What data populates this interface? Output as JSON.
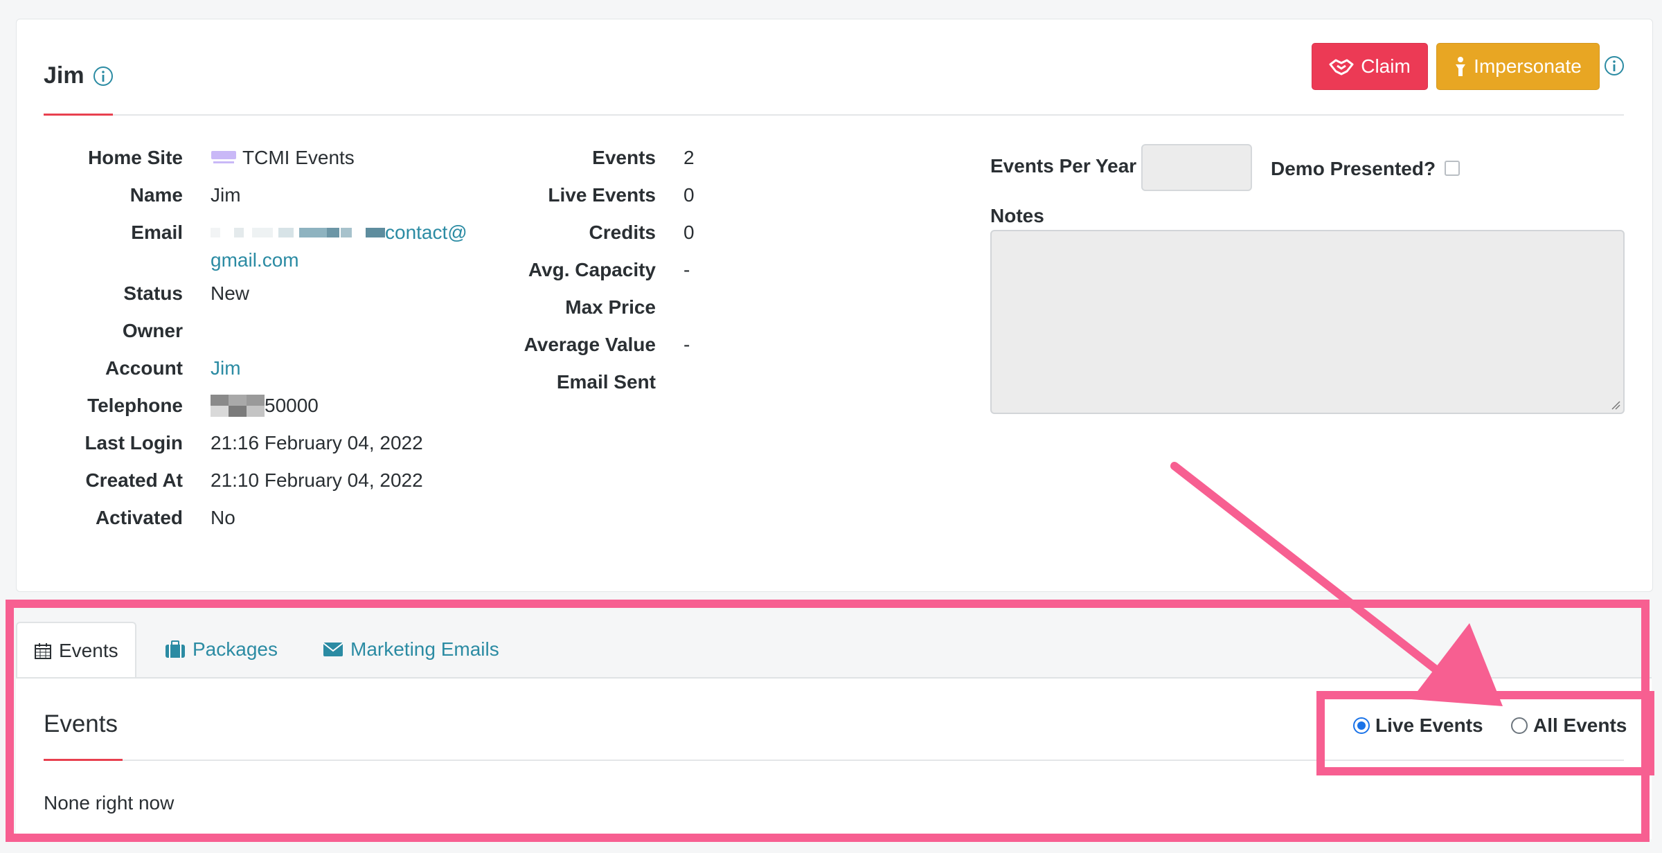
{
  "colors": {
    "accent": "#e8404f",
    "link": "#2b8ba3",
    "claim": "#ec3a55",
    "impersonate": "#e8a623",
    "annotation": "#f75f91"
  },
  "header": {
    "title": "Jim",
    "claim_label": "Claim",
    "impersonate_label": "Impersonate"
  },
  "details": [
    {
      "label": "Home Site",
      "value": "TCMI Events"
    },
    {
      "label": "Name",
      "value": "Jim"
    },
    {
      "label": "Email",
      "value_line1": "contact@",
      "value_line2": "gmail.com"
    },
    {
      "label": "Status",
      "value": "New"
    },
    {
      "label": "Owner",
      "value": ""
    },
    {
      "label": "Account",
      "value": "Jim"
    },
    {
      "label": "Telephone",
      "value": "50000"
    },
    {
      "label": "Last Login",
      "value": "21:16 February 04, 2022"
    },
    {
      "label": "Created At",
      "value": "21:10 February 04, 2022"
    },
    {
      "label": "Activated",
      "value": "No"
    }
  ],
  "stats": [
    {
      "label": "Events",
      "value": "2"
    },
    {
      "label": "Live Events",
      "value": "0"
    },
    {
      "label": "Credits",
      "value": "0"
    },
    {
      "label": "Avg. Capacity",
      "value": "-"
    },
    {
      "label": "Max Price",
      "value": ""
    },
    {
      "label": "Average Value",
      "value": "-"
    },
    {
      "label": "Email Sent",
      "value": ""
    }
  ],
  "form": {
    "events_per_year_label": "Events Per Year",
    "demo_presented_label": "Demo Presented?",
    "notes_label": "Notes"
  },
  "tabs": [
    {
      "label": "Events",
      "icon": "calendar-icon"
    },
    {
      "label": "Packages",
      "icon": "briefcase-icon"
    },
    {
      "label": "Marketing Emails",
      "icon": "envelope-icon"
    }
  ],
  "events_panel": {
    "title": "Events",
    "live_label": "Live Events",
    "all_label": "All Events",
    "empty_text": "None right now"
  }
}
